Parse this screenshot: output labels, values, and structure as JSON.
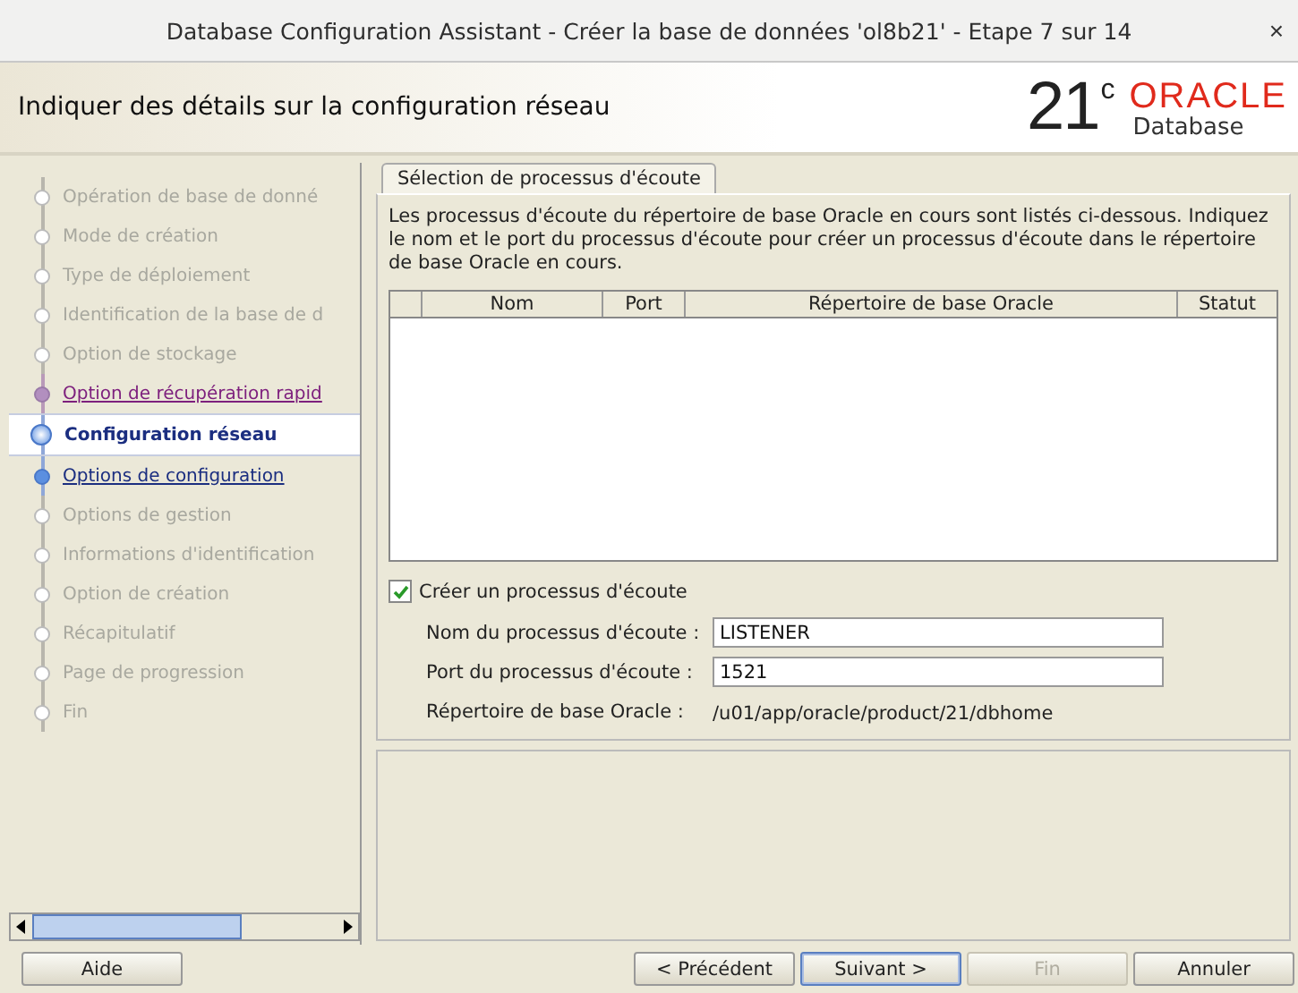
{
  "window": {
    "title": "Database Configuration Assistant - Créer la base de données 'ol8b21' - Etape 7 sur 14",
    "close": "×"
  },
  "header": {
    "title": "Indiquer des détails sur la configuration réseau",
    "logo_version": "21",
    "logo_sup": "c",
    "logo_brand": "ORACLE",
    "logo_product": "Database"
  },
  "steps": [
    {
      "label": "Opération de base de donné",
      "selected": false,
      "visited": false,
      "available": false
    },
    {
      "label": "Mode de création",
      "selected": false,
      "visited": false,
      "available": false
    },
    {
      "label": "Type de déploiement",
      "selected": false,
      "visited": false,
      "available": false
    },
    {
      "label": "Identification de la base de d",
      "selected": false,
      "visited": false,
      "available": false
    },
    {
      "label": "Option de stockage",
      "selected": false,
      "visited": false,
      "available": false
    },
    {
      "label": "Option de récupération rapid",
      "selected": false,
      "visited": true,
      "available": true
    },
    {
      "label": "Configuration réseau",
      "selected": true,
      "visited": false,
      "available": true
    },
    {
      "label": "Options de configuration",
      "selected": false,
      "visited": false,
      "available": true
    },
    {
      "label": "Options de gestion",
      "selected": false,
      "visited": false,
      "available": false
    },
    {
      "label": "Informations d'identification",
      "selected": false,
      "visited": false,
      "available": false
    },
    {
      "label": "Option de création",
      "selected": false,
      "visited": false,
      "available": false
    },
    {
      "label": "Récapitulatif",
      "selected": false,
      "visited": false,
      "available": false
    },
    {
      "label": "Page de progression",
      "selected": false,
      "visited": false,
      "available": false
    },
    {
      "label": "Fin",
      "selected": false,
      "visited": false,
      "available": false
    }
  ],
  "tabs": [
    {
      "label": "Sélection de processus d'écoute",
      "selected": true
    }
  ],
  "description": "Les processus d'écoute du répertoire de base Oracle en cours sont listés ci-dessous. Indiquez le nom et le port du processus d'écoute pour créer un processus d'écoute dans le répertoire de base Oracle en cours.",
  "table": {
    "columns": [
      "Nom",
      "Port",
      "Répertoire de base Oracle",
      "Statut"
    ]
  },
  "create_listener": {
    "label": "Créer un processus d'écoute",
    "checked": true
  },
  "fields": [
    {
      "label": "Nom du processus d'écoute :",
      "value": "LISTENER"
    },
    {
      "label": "Port du processus d'écoute :",
      "value": "1521"
    }
  ],
  "oracle_home": {
    "label": "Répertoire de base Oracle :",
    "value": "/u01/app/oracle/product/21/dbhome"
  },
  "buttons": [
    {
      "label": "Aide",
      "disabled": false,
      "default": false
    },
    {
      "label": "< Précédent",
      "disabled": false,
      "default": false
    },
    {
      "label": "Suivant >",
      "disabled": false,
      "default": true
    },
    {
      "label": "Fin",
      "disabled": true,
      "default": false
    },
    {
      "label": "Annuler",
      "disabled": false,
      "default": false
    }
  ]
}
